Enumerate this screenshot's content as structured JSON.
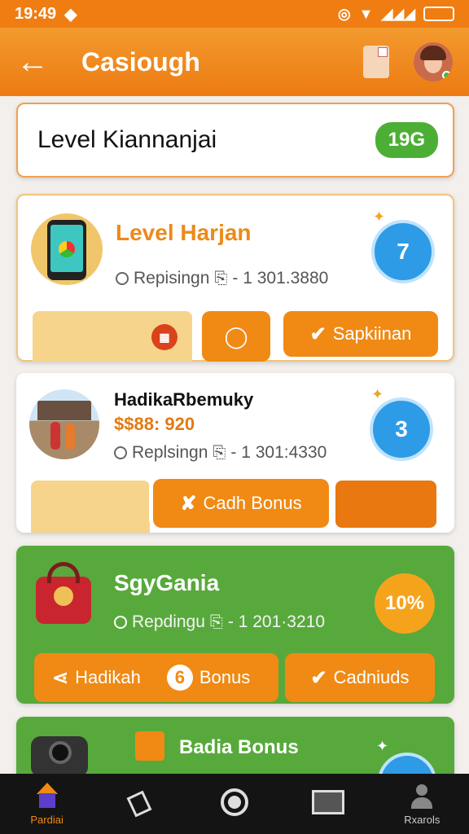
{
  "status_bar": {
    "time": "19:49"
  },
  "app_bar": {
    "title": "Casiough"
  },
  "level_card": {
    "title": "Level Kiannanjai",
    "value": "19G"
  },
  "cards": [
    {
      "name": "Level Harjan",
      "meta": "Repisingn",
      "meta_value": "- 1 301.3880",
      "count": "7",
      "button": "Sapkiinan"
    },
    {
      "name": "HadikaRbemuky",
      "amount": "$$88: 920",
      "meta": "Replsingn",
      "meta_value": "- 1 301:4330",
      "count": "3",
      "button": "Cadh Bonus"
    },
    {
      "name": "SgyGania",
      "meta": "Repdingu",
      "meta_value": "- 1 201·3210",
      "percent": "10%",
      "buttons": [
        "Hadikah",
        "Bonus",
        "Cadniuds"
      ],
      "bonus_icon": "6"
    },
    {
      "name": "Badia Bonus"
    }
  ],
  "bottom_nav": [
    {
      "label": "Pardiai",
      "icon": "home-icon"
    },
    {
      "label": "",
      "icon": "cards-icon"
    },
    {
      "label": "",
      "icon": "circle-icon"
    },
    {
      "label": "",
      "icon": "box-icon"
    },
    {
      "label": "Rxarols",
      "icon": "profile-icon"
    }
  ]
}
